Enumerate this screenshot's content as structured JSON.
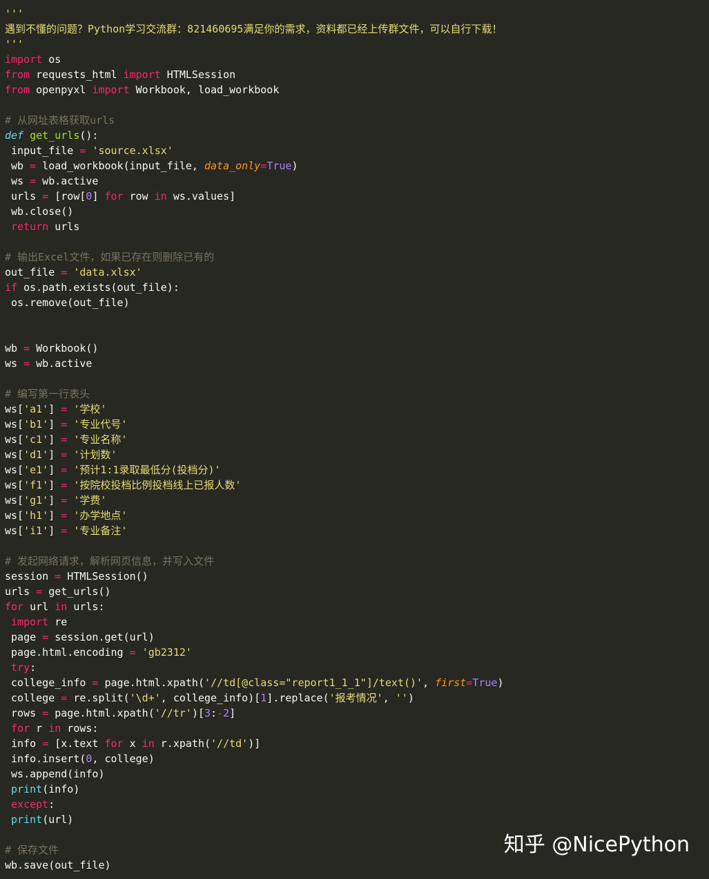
{
  "editor": {
    "lines": [
      [
        {
          "t": "'''",
          "c": "string"
        }
      ],
      [
        {
          "t": "遇到不懂的问题？Python学习交流群：821460695满足你的需求，资料都已经上传群文件，可以自行下载！",
          "c": "string"
        }
      ],
      [
        {
          "t": "'''",
          "c": "string"
        }
      ],
      [
        {
          "t": "import",
          "c": "keyword"
        },
        {
          "t": " os",
          "c": "plain"
        }
      ],
      [
        {
          "t": "from",
          "c": "keyword"
        },
        {
          "t": " requests_html ",
          "c": "plain"
        },
        {
          "t": "import",
          "c": "keyword"
        },
        {
          "t": " HTMLSession",
          "c": "plain"
        }
      ],
      [
        {
          "t": "from",
          "c": "keyword"
        },
        {
          "t": " openpyxl ",
          "c": "plain"
        },
        {
          "t": "import",
          "c": "keyword"
        },
        {
          "t": " Workbook, load_workbook",
          "c": "plain"
        }
      ],
      [],
      [
        {
          "t": "# 从网址表格获取urls",
          "c": "comment"
        }
      ],
      [
        {
          "t": "def",
          "c": "defkw"
        },
        {
          "t": " ",
          "c": "plain"
        },
        {
          "t": "get_urls",
          "c": "funcname"
        },
        {
          "t": "():",
          "c": "plain"
        }
      ],
      [
        {
          "t": " input_file ",
          "c": "plain"
        },
        {
          "t": "=",
          "c": "operator"
        },
        {
          "t": " ",
          "c": "plain"
        },
        {
          "t": "'source.xlsx'",
          "c": "string"
        }
      ],
      [
        {
          "t": " wb ",
          "c": "plain"
        },
        {
          "t": "=",
          "c": "operator"
        },
        {
          "t": " load_workbook(input_file, ",
          "c": "plain"
        },
        {
          "t": "data_only",
          "c": "param"
        },
        {
          "t": "=",
          "c": "operator"
        },
        {
          "t": "True",
          "c": "constant"
        },
        {
          "t": ")",
          "c": "plain"
        }
      ],
      [
        {
          "t": " ws ",
          "c": "plain"
        },
        {
          "t": "=",
          "c": "operator"
        },
        {
          "t": " wb.active",
          "c": "plain"
        }
      ],
      [
        {
          "t": " urls ",
          "c": "plain"
        },
        {
          "t": "=",
          "c": "operator"
        },
        {
          "t": " [row[",
          "c": "plain"
        },
        {
          "t": "0",
          "c": "number"
        },
        {
          "t": "] ",
          "c": "plain"
        },
        {
          "t": "for",
          "c": "keyword"
        },
        {
          "t": " row ",
          "c": "plain"
        },
        {
          "t": "in",
          "c": "keyword"
        },
        {
          "t": " ws.values]",
          "c": "plain"
        }
      ],
      [
        {
          "t": " wb.close()",
          "c": "plain"
        }
      ],
      [
        {
          "t": " ",
          "c": "plain"
        },
        {
          "t": "return",
          "c": "keyword"
        },
        {
          "t": " urls",
          "c": "plain"
        }
      ],
      [],
      [
        {
          "t": "# 输出Excel文件，如果已存在则删除已有的",
          "c": "comment"
        }
      ],
      [
        {
          "t": "out_file ",
          "c": "plain"
        },
        {
          "t": "=",
          "c": "operator"
        },
        {
          "t": " ",
          "c": "plain"
        },
        {
          "t": "'data.xlsx'",
          "c": "string"
        }
      ],
      [
        {
          "t": "if",
          "c": "keyword"
        },
        {
          "t": " os.path.exists(out_file):",
          "c": "plain"
        }
      ],
      [
        {
          "t": " os.remove(out_file)",
          "c": "plain"
        }
      ],
      [],
      [],
      [
        {
          "t": "wb ",
          "c": "plain"
        },
        {
          "t": "=",
          "c": "operator"
        },
        {
          "t": " Workbook()",
          "c": "plain"
        }
      ],
      [
        {
          "t": "ws ",
          "c": "plain"
        },
        {
          "t": "=",
          "c": "operator"
        },
        {
          "t": " wb.active",
          "c": "plain"
        }
      ],
      [],
      [
        {
          "t": "# 编写第一行表头",
          "c": "comment"
        }
      ],
      [
        {
          "t": "ws[",
          "c": "plain"
        },
        {
          "t": "'a1'",
          "c": "string"
        },
        {
          "t": "] ",
          "c": "plain"
        },
        {
          "t": "=",
          "c": "operator"
        },
        {
          "t": " ",
          "c": "plain"
        },
        {
          "t": "'学校'",
          "c": "string"
        }
      ],
      [
        {
          "t": "ws[",
          "c": "plain"
        },
        {
          "t": "'b1'",
          "c": "string"
        },
        {
          "t": "] ",
          "c": "plain"
        },
        {
          "t": "=",
          "c": "operator"
        },
        {
          "t": " ",
          "c": "plain"
        },
        {
          "t": "'专业代号'",
          "c": "string"
        }
      ],
      [
        {
          "t": "ws[",
          "c": "plain"
        },
        {
          "t": "'c1'",
          "c": "string"
        },
        {
          "t": "] ",
          "c": "plain"
        },
        {
          "t": "=",
          "c": "operator"
        },
        {
          "t": " ",
          "c": "plain"
        },
        {
          "t": "'专业名称'",
          "c": "string"
        }
      ],
      [
        {
          "t": "ws[",
          "c": "plain"
        },
        {
          "t": "'d1'",
          "c": "string"
        },
        {
          "t": "] ",
          "c": "plain"
        },
        {
          "t": "=",
          "c": "operator"
        },
        {
          "t": " ",
          "c": "plain"
        },
        {
          "t": "'计划数'",
          "c": "string"
        }
      ],
      [
        {
          "t": "ws[",
          "c": "plain"
        },
        {
          "t": "'e1'",
          "c": "string"
        },
        {
          "t": "] ",
          "c": "plain"
        },
        {
          "t": "=",
          "c": "operator"
        },
        {
          "t": " ",
          "c": "plain"
        },
        {
          "t": "'预计1:1录取最低分(投档分)'",
          "c": "string"
        }
      ],
      [
        {
          "t": "ws[",
          "c": "plain"
        },
        {
          "t": "'f1'",
          "c": "string"
        },
        {
          "t": "] ",
          "c": "plain"
        },
        {
          "t": "=",
          "c": "operator"
        },
        {
          "t": " ",
          "c": "plain"
        },
        {
          "t": "'按院校投档比例投档线上已报人数'",
          "c": "string"
        }
      ],
      [
        {
          "t": "ws[",
          "c": "plain"
        },
        {
          "t": "'g1'",
          "c": "string"
        },
        {
          "t": "] ",
          "c": "plain"
        },
        {
          "t": "=",
          "c": "operator"
        },
        {
          "t": " ",
          "c": "plain"
        },
        {
          "t": "'学费'",
          "c": "string"
        }
      ],
      [
        {
          "t": "ws[",
          "c": "plain"
        },
        {
          "t": "'h1'",
          "c": "string"
        },
        {
          "t": "] ",
          "c": "plain"
        },
        {
          "t": "=",
          "c": "operator"
        },
        {
          "t": " ",
          "c": "plain"
        },
        {
          "t": "'办学地点'",
          "c": "string"
        }
      ],
      [
        {
          "t": "ws[",
          "c": "plain"
        },
        {
          "t": "'i1'",
          "c": "string"
        },
        {
          "t": "] ",
          "c": "plain"
        },
        {
          "t": "=",
          "c": "operator"
        },
        {
          "t": " ",
          "c": "plain"
        },
        {
          "t": "'专业备注'",
          "c": "string"
        }
      ],
      [],
      [
        {
          "t": "# 发起网络请求，解析网页信息，并写入文件",
          "c": "comment"
        }
      ],
      [
        {
          "t": "session ",
          "c": "plain"
        },
        {
          "t": "=",
          "c": "operator"
        },
        {
          "t": " HTMLSession()",
          "c": "plain"
        }
      ],
      [
        {
          "t": "urls ",
          "c": "plain"
        },
        {
          "t": "=",
          "c": "operator"
        },
        {
          "t": " get_urls()",
          "c": "plain"
        }
      ],
      [
        {
          "t": "for",
          "c": "keyword"
        },
        {
          "t": " url ",
          "c": "plain"
        },
        {
          "t": "in",
          "c": "keyword"
        },
        {
          "t": " urls:",
          "c": "plain"
        }
      ],
      [
        {
          "t": " ",
          "c": "plain"
        },
        {
          "t": "import",
          "c": "keyword"
        },
        {
          "t": " re",
          "c": "plain"
        }
      ],
      [
        {
          "t": " page ",
          "c": "plain"
        },
        {
          "t": "=",
          "c": "operator"
        },
        {
          "t": " session.get(url)",
          "c": "plain"
        }
      ],
      [
        {
          "t": " page.html.encoding ",
          "c": "plain"
        },
        {
          "t": "=",
          "c": "operator"
        },
        {
          "t": " ",
          "c": "plain"
        },
        {
          "t": "'gb2312'",
          "c": "string"
        }
      ],
      [
        {
          "t": " ",
          "c": "plain"
        },
        {
          "t": "try",
          "c": "keyword"
        },
        {
          "t": ":",
          "c": "plain"
        }
      ],
      [
        {
          "t": " college_info ",
          "c": "plain"
        },
        {
          "t": "=",
          "c": "operator"
        },
        {
          "t": " page.html.xpath(",
          "c": "plain"
        },
        {
          "t": "'//td[@class=\"report1_1_1\"]/text()'",
          "c": "string"
        },
        {
          "t": ", ",
          "c": "plain"
        },
        {
          "t": "first",
          "c": "param"
        },
        {
          "t": "=",
          "c": "operator"
        },
        {
          "t": "True",
          "c": "constant"
        },
        {
          "t": ")",
          "c": "plain"
        }
      ],
      [
        {
          "t": " college ",
          "c": "plain"
        },
        {
          "t": "=",
          "c": "operator"
        },
        {
          "t": " re.split(",
          "c": "plain"
        },
        {
          "t": "'\\d+'",
          "c": "string"
        },
        {
          "t": ", college_info)[",
          "c": "plain"
        },
        {
          "t": "1",
          "c": "number"
        },
        {
          "t": "].replace(",
          "c": "plain"
        },
        {
          "t": "'报考情况'",
          "c": "string"
        },
        {
          "t": ", ",
          "c": "plain"
        },
        {
          "t": "''",
          "c": "string"
        },
        {
          "t": ")",
          "c": "plain"
        }
      ],
      [
        {
          "t": " rows ",
          "c": "plain"
        },
        {
          "t": "=",
          "c": "operator"
        },
        {
          "t": " page.html.xpath(",
          "c": "plain"
        },
        {
          "t": "'//tr'",
          "c": "string"
        },
        {
          "t": ")[",
          "c": "plain"
        },
        {
          "t": "3",
          "c": "number"
        },
        {
          "t": ":",
          "c": "plain"
        },
        {
          "t": "-",
          "c": "operator"
        },
        {
          "t": "2",
          "c": "number"
        },
        {
          "t": "]",
          "c": "plain"
        }
      ],
      [
        {
          "t": " ",
          "c": "plain"
        },
        {
          "t": "for",
          "c": "keyword"
        },
        {
          "t": " r ",
          "c": "plain"
        },
        {
          "t": "in",
          "c": "keyword"
        },
        {
          "t": " rows:",
          "c": "plain"
        }
      ],
      [
        {
          "t": " info ",
          "c": "plain"
        },
        {
          "t": "=",
          "c": "operator"
        },
        {
          "t": " [x.text ",
          "c": "plain"
        },
        {
          "t": "for",
          "c": "keyword"
        },
        {
          "t": " x ",
          "c": "plain"
        },
        {
          "t": "in",
          "c": "keyword"
        },
        {
          "t": " r.xpath(",
          "c": "plain"
        },
        {
          "t": "'//td'",
          "c": "string"
        },
        {
          "t": ")]",
          "c": "plain"
        }
      ],
      [
        {
          "t": " info.insert(",
          "c": "plain"
        },
        {
          "t": "0",
          "c": "number"
        },
        {
          "t": ", college)",
          "c": "plain"
        }
      ],
      [
        {
          "t": " ws.append(info)",
          "c": "plain"
        }
      ],
      [
        {
          "t": " ",
          "c": "plain"
        },
        {
          "t": "print",
          "c": "builtin"
        },
        {
          "t": "(info)",
          "c": "plain"
        }
      ],
      [
        {
          "t": " ",
          "c": "plain"
        },
        {
          "t": "except",
          "c": "keyword"
        },
        {
          "t": ":",
          "c": "plain"
        }
      ],
      [
        {
          "t": " ",
          "c": "plain"
        },
        {
          "t": "print",
          "c": "builtin"
        },
        {
          "t": "(url)",
          "c": "plain"
        }
      ],
      [],
      [
        {
          "t": "# 保存文件",
          "c": "comment"
        }
      ],
      [
        {
          "t": "wb.save(out_file)",
          "c": "plain"
        }
      ]
    ]
  },
  "watermark": {
    "text": "知乎 @NicePython"
  },
  "colors": {
    "background": "#272822",
    "plain": "#f8f8f2",
    "keyword": "#f92672",
    "string": "#e6db74",
    "comment": "#75715e",
    "number": "#ae81ff",
    "builtin": "#66d9ef",
    "function": "#a6e22e",
    "param": "#fd971f"
  }
}
